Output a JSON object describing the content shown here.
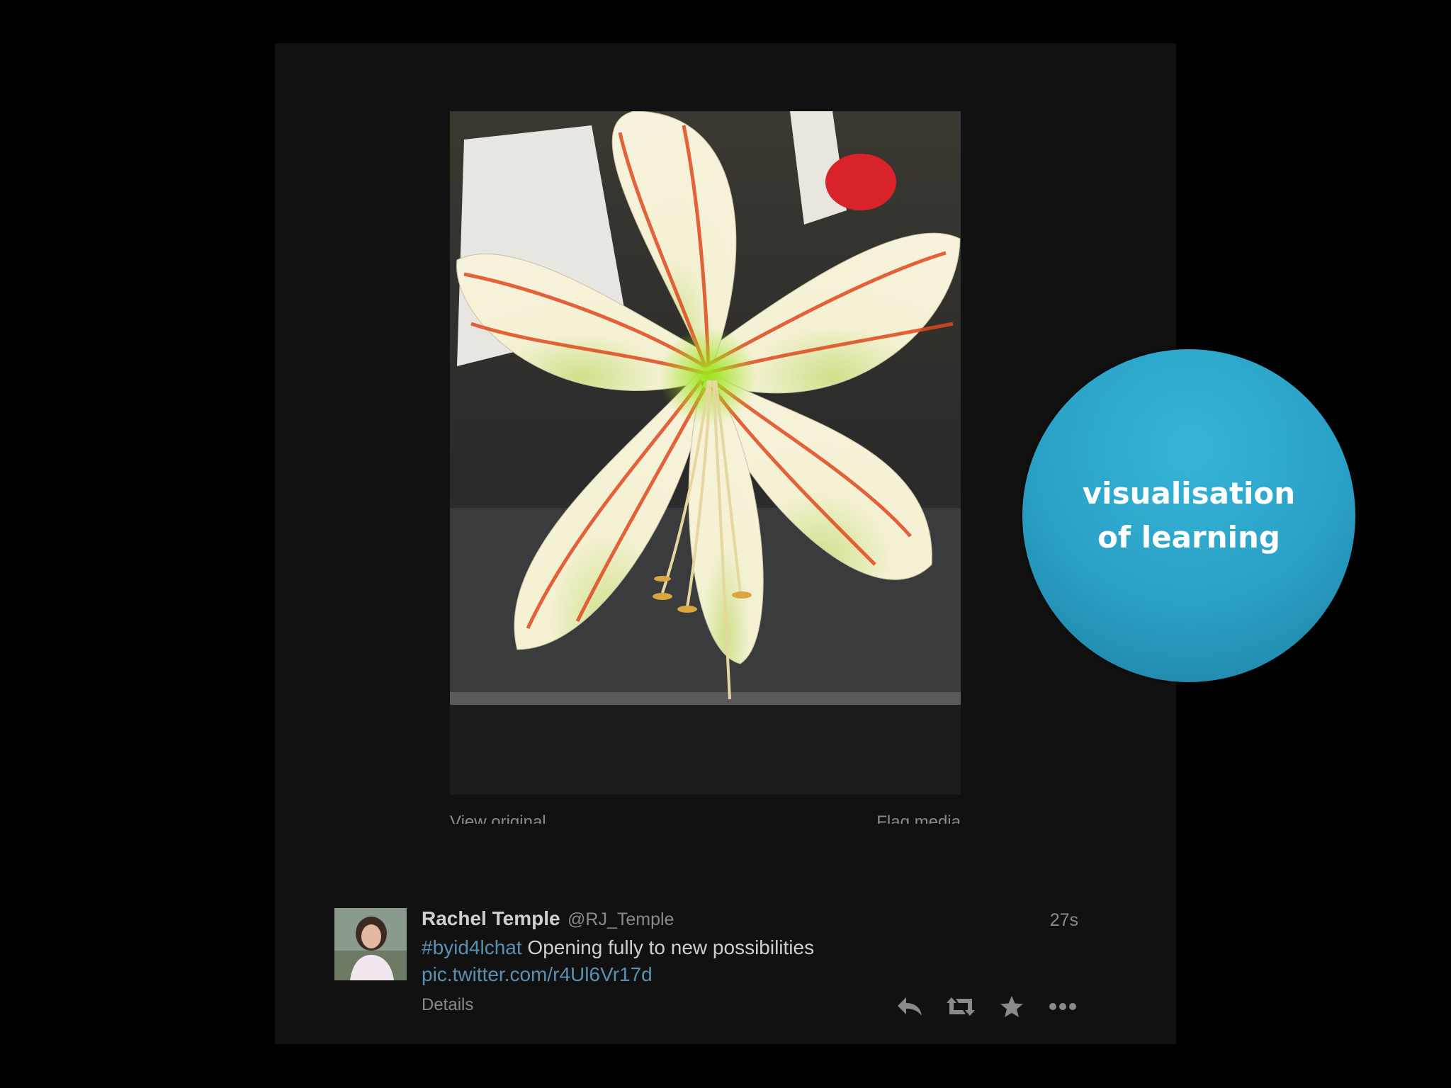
{
  "media": {
    "view_original": "View original",
    "flag_media": "Flag media"
  },
  "tweet": {
    "name": "Rachel Temple",
    "handle": "@RJ_Temple",
    "time": "27s",
    "hashtag": "#byid4lchat",
    "text": " Opening fully to new possibilities",
    "pic_link": "pic.twitter.com/r4Ul6Vr17d",
    "details": "Details",
    "actions": [
      "reply-icon",
      "retweet-icon",
      "favorite-icon",
      "more-icon"
    ]
  },
  "callout": {
    "line1": "visualisation",
    "line2": "of learning",
    "color": "#2aa0c6"
  },
  "colors": {
    "link": "#5b8fb0",
    "panel": "#111111"
  }
}
